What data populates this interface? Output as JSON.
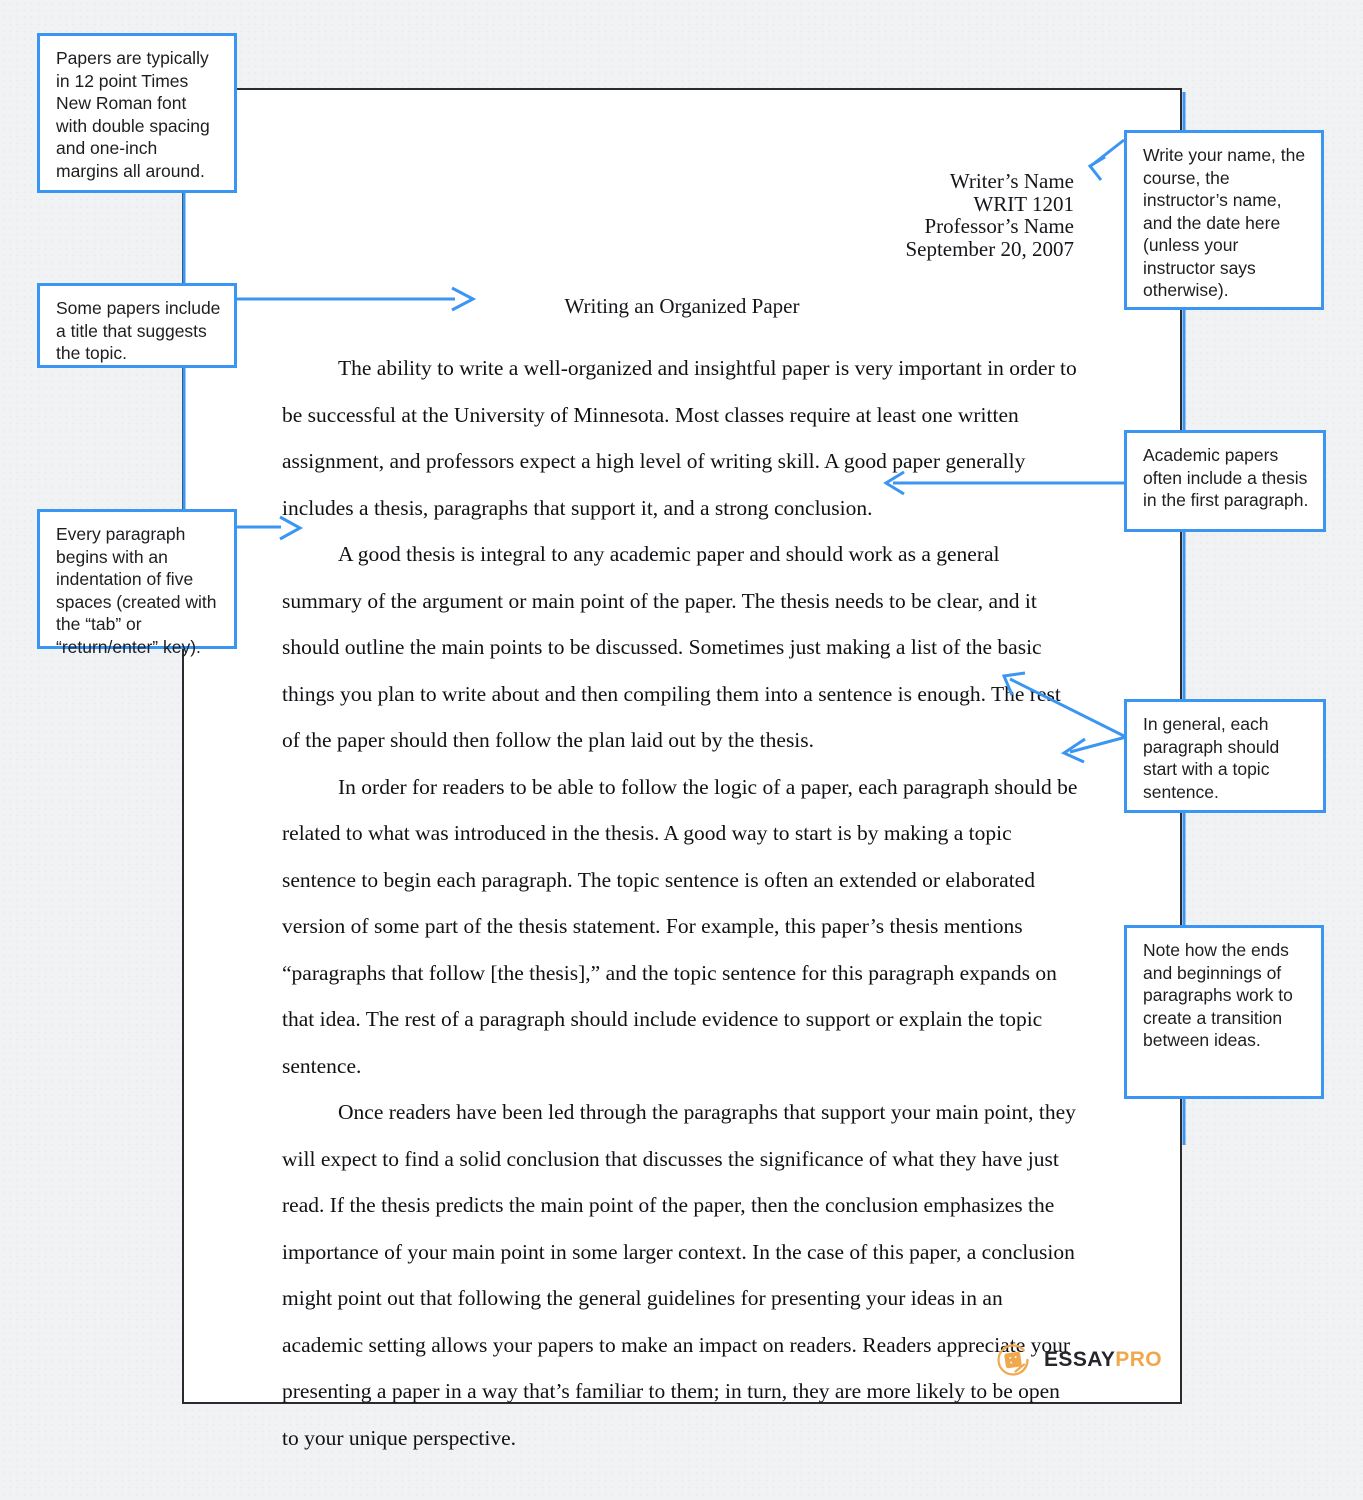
{
  "document": {
    "header_lines": [
      "Writer’s Name",
      "WRIT 1201",
      "Professor’s Name",
      "September 20, 2007"
    ],
    "title": "Writing an Organized Paper",
    "paragraphs": [
      "The ability to write a well-organized and insightful paper is very important in order to be successful at the University of Minnesota. Most classes require at least one written assignment, and professors expect a high level of writing skill. A good paper generally includes a thesis, paragraphs that support it, and a strong conclusion.",
      "A good thesis is integral to any academic paper and should work as a general summary of the argument or main point of the paper. The thesis needs to be clear, and it should outline the main points to be discussed. Sometimes just making a list of the basic things you plan to write about and then compiling them into a sentence is enough. The rest of the paper should then follow the plan laid out by the thesis.",
      "In order for readers to be able to follow the logic of a paper, each paragraph should be related to what was introduced in the thesis. A good way to start is by making a topic sentence to begin each paragraph. The topic sentence is often an extended or elaborated version of some part of the thesis statement. For example, this paper’s thesis mentions “paragraphs that follow [the thesis],” and the topic sentence for this paragraph expands on that idea. The rest of a paragraph should include evidence to support or explain the topic sentence.",
      "Once readers have been led through the paragraphs that support your main point, they will expect to find a solid conclusion that discusses the significance of what they have just read. If the thesis predicts the main point of the paper, then the conclusion emphasizes the importance of your main point in some larger context. In the case of this paper, a conclusion might point out that following the general guidelines for presenting your ideas in an academic setting allows your papers to make an impact on readers. Readers appreciate your presenting a paper in a way that’s familiar to them; in turn, they are more likely to be open to your unique perspective."
    ]
  },
  "annotations": {
    "formatting": "Papers are typically in 12 point Times New Roman font with double spacing and one-inch margins all around.",
    "title_note": "Some papers include a title that suggests the topic.",
    "indentation": "Every paragraph begins with an indentation of five spaces (created with the “tab” or “return/enter” key).",
    "heading_block": "Write your name, the course, the instructor’s name, and the date here (unless your instructor says otherwise).",
    "thesis": "Academic papers often include a thesis in the first paragraph.",
    "topic_sentence": "In general, each paragraph should start with a topic sentence.",
    "transitions": "Note how the ends and beginnings of paragraphs work to create a transition between ideas."
  },
  "logo": {
    "name_primary": "ESSAY",
    "name_secondary": "PRO",
    "icon": "essaypro-mark-icon",
    "accent_color": "#f0a84e"
  },
  "theme": {
    "callout_border": "#3b96f3",
    "page_border": "#2b2b2f",
    "backdrop": "#f1f2f4"
  }
}
